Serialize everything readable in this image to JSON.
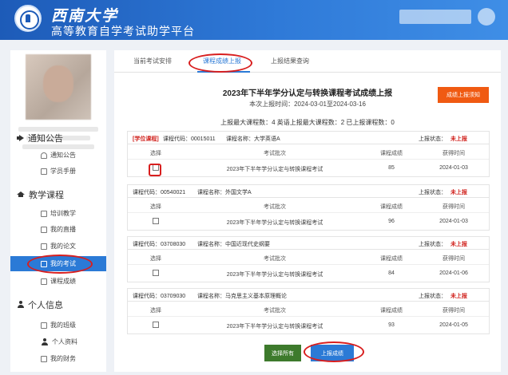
{
  "header": {
    "university": "西南大学",
    "platform": "高等教育自学考试助学平台"
  },
  "sidebar": {
    "sections": [
      {
        "title": "通知公告",
        "icon": "megaphone-icon",
        "items": [
          {
            "label": "通知公告",
            "icon": "bell-icon"
          },
          {
            "label": "学员手册",
            "icon": "document-icon"
          }
        ]
      },
      {
        "title": "教学课程",
        "icon": "graduation-cap-icon",
        "items": [
          {
            "label": "培训教学",
            "icon": "document-icon"
          },
          {
            "label": "我的直播",
            "icon": "document-icon"
          },
          {
            "label": "我的论文",
            "icon": "document-icon"
          },
          {
            "label": "我的考试",
            "icon": "document-icon",
            "active": true
          },
          {
            "label": "课程成绩",
            "icon": "document-icon"
          }
        ]
      },
      {
        "title": "个人信息",
        "icon": "user-icon",
        "items": [
          {
            "label": "我的班级",
            "icon": "document-icon"
          },
          {
            "label": "个人资料",
            "icon": "user-icon"
          },
          {
            "label": "我的财务",
            "icon": "document-icon"
          }
        ]
      }
    ]
  },
  "tabs": [
    {
      "label": "当前考试安排",
      "active": false
    },
    {
      "label": "课程成绩上报",
      "active": true
    },
    {
      "label": "上报结果查询",
      "active": false
    }
  ],
  "main": {
    "title": "2023年下半年学分认定与转换课程考试成绩上报",
    "period": "本次上报时间：2024-03-01至2024-03-16",
    "report_button": "成绩上报须知",
    "counts": "上报最大课程数：4    英语上报最大课程数：2    已上报课程数：0",
    "columns": {
      "select": "选择",
      "batch": "考试批次",
      "score": "课程成绩",
      "time": "获得时间"
    },
    "status_label": "上报状态：",
    "courses": [
      {
        "tag": "[学位课程]",
        "code_label": "课程代码：00015011",
        "name_label": "课程名称：大学英语A",
        "status": "未上报",
        "batch": "2023年下半年学分认定与转换课程考试",
        "score": "85",
        "time": "2024-01-03"
      },
      {
        "tag": "",
        "code_label": "课程代码：00540021",
        "name_label": "课程名称：外国文学A",
        "status": "未上报",
        "batch": "2023年下半年学分认定与转换课程考试",
        "score": "96",
        "time": "2024-01-03"
      },
      {
        "tag": "",
        "code_label": "课程代码：03708030",
        "name_label": "课程名称：中国近现代史纲要",
        "status": "未上报",
        "batch": "2023年下半年学分认定与转换课程考试",
        "score": "84",
        "time": "2024-01-06"
      },
      {
        "tag": "",
        "code_label": "课程代码：03709030",
        "name_label": "课程名称：马克思主义基本原理概论",
        "status": "未上报",
        "batch": "2023年下半年学分认定与转换课程考试",
        "score": "93",
        "time": "2024-01-05"
      }
    ],
    "select_all_button": "选择所有",
    "upload_button": "上报成绩"
  },
  "colors": {
    "header_blue": "#1d5bb8",
    "accent_blue": "#2b7ad6",
    "orange": "#f05a12",
    "green": "#3d7a2c",
    "status_red": "#d0211c",
    "annotation_red": "#d81e1e"
  }
}
